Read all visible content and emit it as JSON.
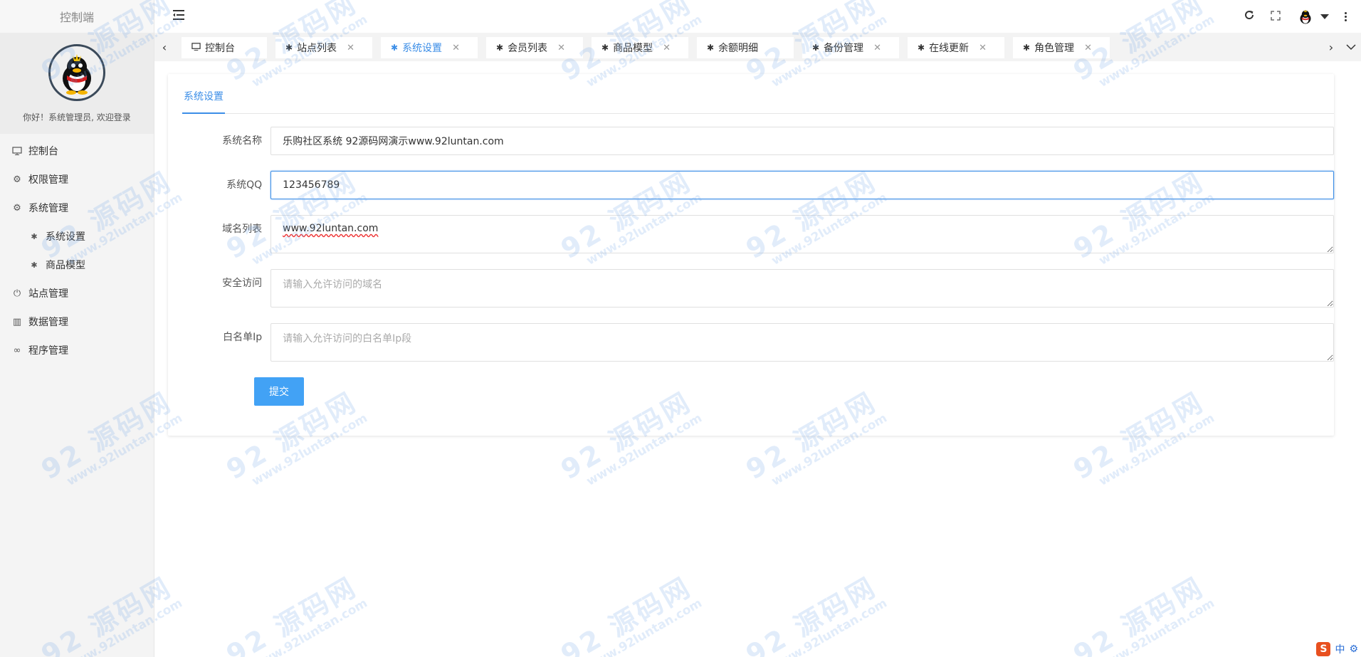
{
  "sidebar": {
    "brand": "控制端",
    "welcome": "你好！系统管理员, 欢迎登录",
    "items": [
      {
        "label": "控制台",
        "icon": "monitor-icon",
        "sub": false
      },
      {
        "label": "权限管理",
        "icon": "gear-icon",
        "sub": false
      },
      {
        "label": "系统管理",
        "icon": "gear-icon",
        "sub": false
      },
      {
        "label": "系统设置",
        "icon": "palm-icon",
        "sub": true
      },
      {
        "label": "商品模型",
        "icon": "palm-icon",
        "sub": true
      },
      {
        "label": "站点管理",
        "icon": "power-icon",
        "sub": false
      },
      {
        "label": "数据管理",
        "icon": "table-icon",
        "sub": false
      },
      {
        "label": "程序管理",
        "icon": "infinity-icon",
        "sub": false
      }
    ]
  },
  "tabs": [
    {
      "label": "控制台",
      "closable": false
    },
    {
      "label": "站点列表",
      "closable": true
    },
    {
      "label": "系统设置",
      "closable": true,
      "active": true
    },
    {
      "label": "会员列表",
      "closable": true
    },
    {
      "label": "商品模型",
      "closable": true
    },
    {
      "label": "余额明细",
      "closable": false
    },
    {
      "label": "备份管理",
      "closable": true
    },
    {
      "label": "在线更新",
      "closable": true
    },
    {
      "label": "角色管理",
      "closable": true
    }
  ],
  "content": {
    "tab": "系统设置",
    "fields": {
      "name": {
        "label": "系统名称",
        "value": "乐购社区系统 92源码网演示www.92luntan.com"
      },
      "qq": {
        "label": "系统QQ",
        "value": "123456789"
      },
      "domains": {
        "label": "域名列表",
        "value": "www.92luntan.com"
      },
      "secure": {
        "label": "安全访问",
        "placeholder": "请输入允许访问的域名"
      },
      "whitelist": {
        "label": "白名单Ip",
        "placeholder": "请输入允许访问的白名单Ip段"
      }
    },
    "submit": "提交"
  },
  "watermark": {
    "big": "92 源码网",
    "small": "www.92luntan.com"
  },
  "ime": {
    "logo": "S",
    "text": "中"
  },
  "colors": {
    "accent": "#3c8ee7",
    "button": "#42a2f5"
  }
}
